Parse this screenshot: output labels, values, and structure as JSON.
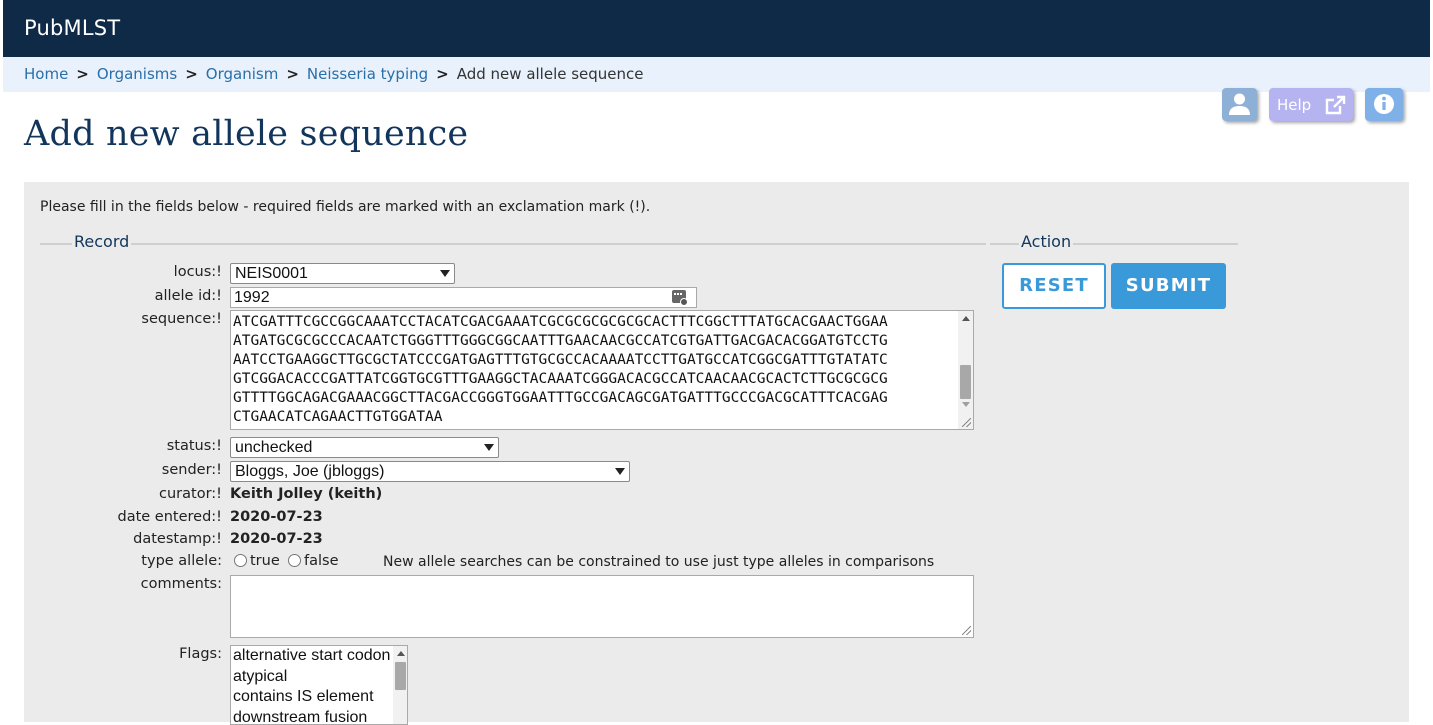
{
  "header": {
    "brand": "PubMLST"
  },
  "breadcrumb": {
    "items": [
      "Home",
      "Organisms",
      "Organism",
      "Neisseria typing"
    ],
    "separator": ">",
    "current": "Add new allele sequence"
  },
  "toolbar": {
    "help_label": "Help",
    "icons": [
      "user-icon",
      "external-link-icon",
      "info-icon"
    ]
  },
  "page": {
    "title": "Add new allele sequence"
  },
  "form": {
    "intro": "Please fill in the fields below - required fields are marked with an exclamation mark (!).",
    "record_legend": "Record",
    "action_legend": "Action",
    "fields": {
      "locus": {
        "label": "locus:!",
        "value": "NEIS0001"
      },
      "allele_id": {
        "label": "allele id:!",
        "value": "1992"
      },
      "sequence": {
        "label": "sequence:!",
        "lines": [
          "ATCGATTTCGCCGGCAAATCCTACATCGACGAAATCGCGCGCGCGCGCACTTTCGGCTTTATGCACGAACTGGAA",
          "ATGATGCGCGCCCACAATCTGGGTTTGGGCGGCAATTTGAACAACGCCATCGTGATTGACGACACGGATGTCCTG",
          "AATCCTGAAGGCTTGCGCTATCCCGATGAGTTTGTGCGCCACAAAATCCTTGATGCCATCGGCGATTTGTATATC",
          "GTCGGACACCCGATTATCGGTGCGTTTGAAGGCTACAAATCGGGACACGCCATCAACAACGCACTCTTGCGCGCG",
          "GTTTTGGCAGACGAAACGGCTTACGACCGGGTGGAATTTGCCGACAGCGATGATTTGCCCGACGCATTTCACGAG",
          "CTGAACATCAGAACTTGTGGATAA"
        ]
      },
      "status": {
        "label": "status:!",
        "value": "unchecked"
      },
      "sender": {
        "label": "sender:!",
        "value": "Bloggs, Joe (jbloggs)"
      },
      "curator": {
        "label": "curator:!",
        "value": "Keith Jolley (keith)"
      },
      "date_entered": {
        "label": "date entered:!",
        "value": "2020-07-23"
      },
      "datestamp": {
        "label": "datestamp:!",
        "value": "2020-07-23"
      },
      "type_allele": {
        "label": "type allele:",
        "options": [
          "true",
          "false"
        ],
        "note": "New allele searches can be constrained to use just type alleles in comparisons"
      },
      "comments": {
        "label": "comments:",
        "value": ""
      },
      "flags": {
        "label": "Flags:",
        "options": [
          "alternative start codon",
          "atypical",
          "contains IS element",
          "downstream fusion"
        ]
      }
    },
    "buttons": {
      "reset": "RESET",
      "submit": "SUBMIT"
    }
  },
  "colors": {
    "topbar": "#0f2a47",
    "breadcrumb_bg": "#e8f1fc",
    "link": "#2a6fa8",
    "title": "#12355b",
    "panel_bg": "#ebebeb",
    "accent": "#3a9ad9"
  }
}
